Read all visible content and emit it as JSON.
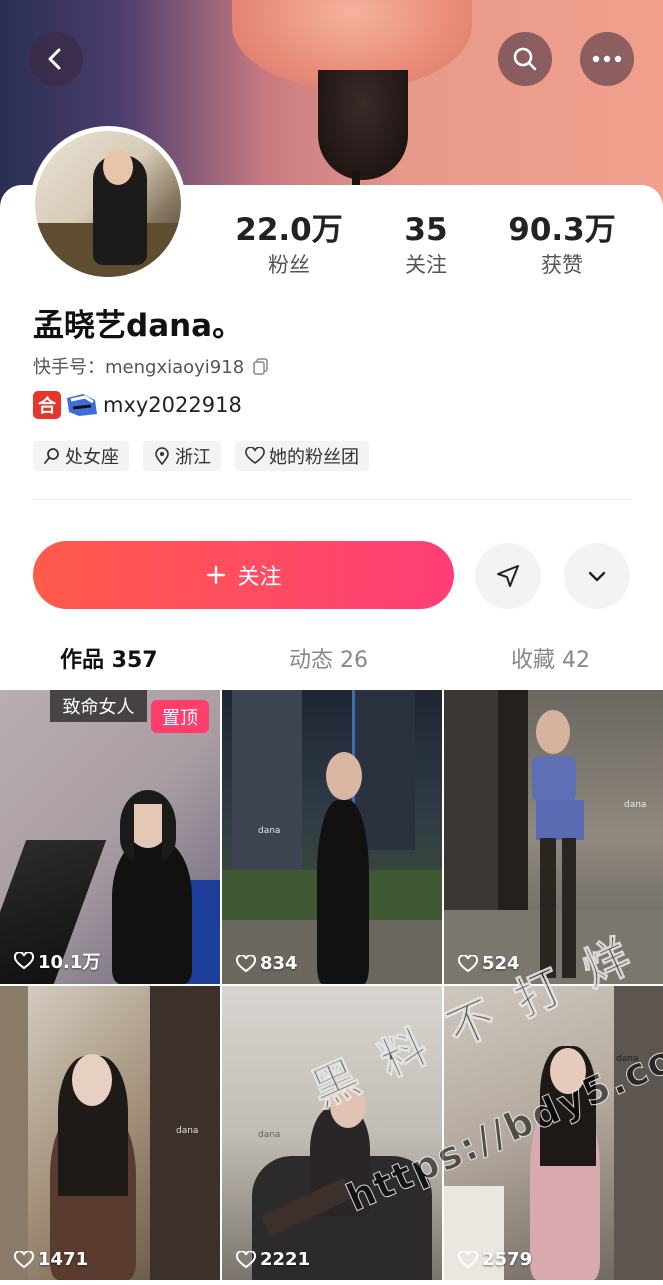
{
  "profile": {
    "stats": [
      {
        "num": "22.0万",
        "label": "粉丝"
      },
      {
        "num": "35",
        "label": "关注"
      },
      {
        "num": "90.3万",
        "label": "获赞"
      }
    ],
    "name": "孟晓艺dana。",
    "id_line": "快手号：mengxiaoyi918",
    "badge_text": "mxy2022918",
    "badge_icon_text": "合",
    "tags": [
      {
        "icon": "zodiac-icon",
        "label": "处女座"
      },
      {
        "icon": "location-icon",
        "label": "浙江"
      },
      {
        "icon": "heart-icon",
        "label": "她的粉丝团"
      }
    ]
  },
  "actions": {
    "follow_label": "关注"
  },
  "tabs": [
    {
      "label": "作品 357",
      "active": true
    },
    {
      "label": "动态 26",
      "active": false
    },
    {
      "label": "收藏 42",
      "active": false
    }
  ],
  "videos": [
    {
      "likes": "10.1万",
      "caption": "致命女人",
      "pin": "置顶"
    },
    {
      "likes": "834"
    },
    {
      "likes": "524"
    },
    {
      "likes": "1471"
    },
    {
      "likes": "2221"
    },
    {
      "likes": "2579"
    }
  ],
  "video_watermark_text": "dana",
  "watermark": {
    "line1": "黑 料 不 打 烊",
    "line2": "https://bdy5.co"
  }
}
